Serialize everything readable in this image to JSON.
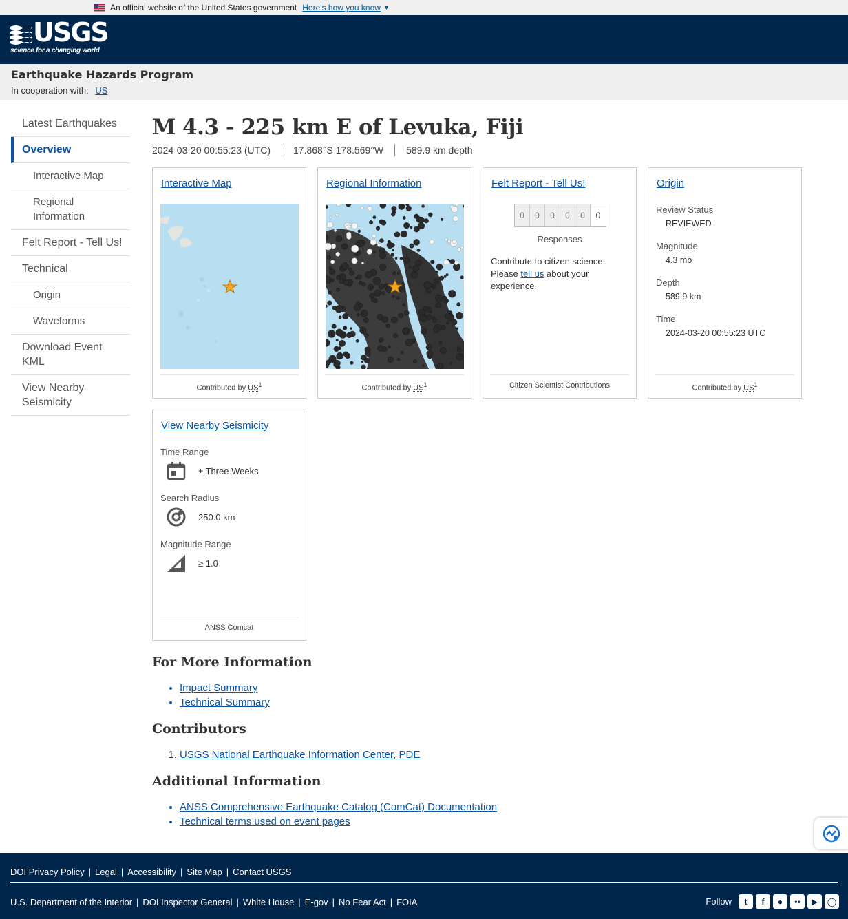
{
  "gov_banner": {
    "text": "An official website of the United States government",
    "howto": "Here's how you know"
  },
  "header": {
    "logo_text": "USGS",
    "logo_tagline": "science for a changing world"
  },
  "program": {
    "title": "Earthquake Hazards Program",
    "coop_label": "In cooperation with:",
    "coop_link": "US"
  },
  "sidebar": {
    "items": [
      {
        "label": "Latest Earthquakes"
      },
      {
        "label": "Overview"
      },
      {
        "label": "Interactive Map"
      },
      {
        "label": "Regional Information"
      },
      {
        "label": "Felt Report - Tell Us!"
      },
      {
        "label": "Technical"
      },
      {
        "label": "Origin"
      },
      {
        "label": "Waveforms"
      },
      {
        "label": "Download Event KML"
      },
      {
        "label": "View Nearby Seismicity"
      }
    ]
  },
  "event": {
    "title": "M 4.3 - 225 km E of Levuka, Fiji",
    "time": "2024-03-20 00:55:23 (UTC)",
    "location": "17.868°S 178.569°W",
    "depth": "589.9 km depth"
  },
  "cards": {
    "map": {
      "link": "Interactive Map",
      "foot_prefix": "Contributed by",
      "foot_net": "US",
      "foot_sup": "1"
    },
    "regional": {
      "link": "Regional Information",
      "foot_prefix": "Contributed by",
      "foot_net": "US",
      "foot_sup": "1"
    },
    "felt": {
      "link": "Felt Report - Tell Us!",
      "digits": [
        "0",
        "0",
        "0",
        "0",
        "0",
        "0"
      ],
      "responses": "Responses",
      "text_before": "Contribute to citizen science. Please",
      "tell_us": "tell us",
      "text_after": "about your experience.",
      "foot": "Citizen Scientist Contributions"
    },
    "origin": {
      "link": "Origin",
      "review_label": "Review Status",
      "review_value": "REVIEWED",
      "mag_label": "Magnitude",
      "mag_value": "4.3 mb",
      "depth_label": "Depth",
      "depth_value": "589.9 km",
      "time_label": "Time",
      "time_value": "2024-03-20 00:55:23 UTC",
      "foot_prefix": "Contributed by",
      "foot_net": "US",
      "foot_sup": "1"
    },
    "nearby": {
      "link": "View Nearby Seismicity",
      "time_label": "Time Range",
      "time_value": "± Three Weeks",
      "radius_label": "Search Radius",
      "radius_value": "250.0 km",
      "mag_label": "Magnitude Range",
      "mag_value": "≥ 1.0",
      "foot": "ANSS Comcat"
    }
  },
  "info": {
    "more_title": "For More Information",
    "more_links": [
      "Impact Summary",
      "Technical Summary"
    ],
    "contrib_title": "Contributors",
    "contrib_links": [
      "USGS National Earthquake Information Center, PDE"
    ],
    "additional_title": "Additional Information",
    "additional_links": [
      "ANSS Comprehensive Earthquake Catalog (ComCat) Documentation",
      "Technical terms used on event pages"
    ]
  },
  "footer": {
    "row1": [
      "DOI Privacy Policy",
      "Legal",
      "Accessibility",
      "Site Map",
      "Contact USGS"
    ],
    "row2": [
      "U.S. Department of the Interior",
      "DOI Inspector General",
      "White House",
      "E-gov",
      "No Fear Act",
      "FOIA"
    ],
    "follow": "Follow",
    "social_icons": [
      "twitter-icon",
      "facebook-icon",
      "github-icon",
      "flickr-icon",
      "youtube-icon",
      "instagram-icon"
    ]
  },
  "colors": {
    "header_bg": "#00264c",
    "link": "#0a55a8",
    "star": "#f5a623"
  }
}
